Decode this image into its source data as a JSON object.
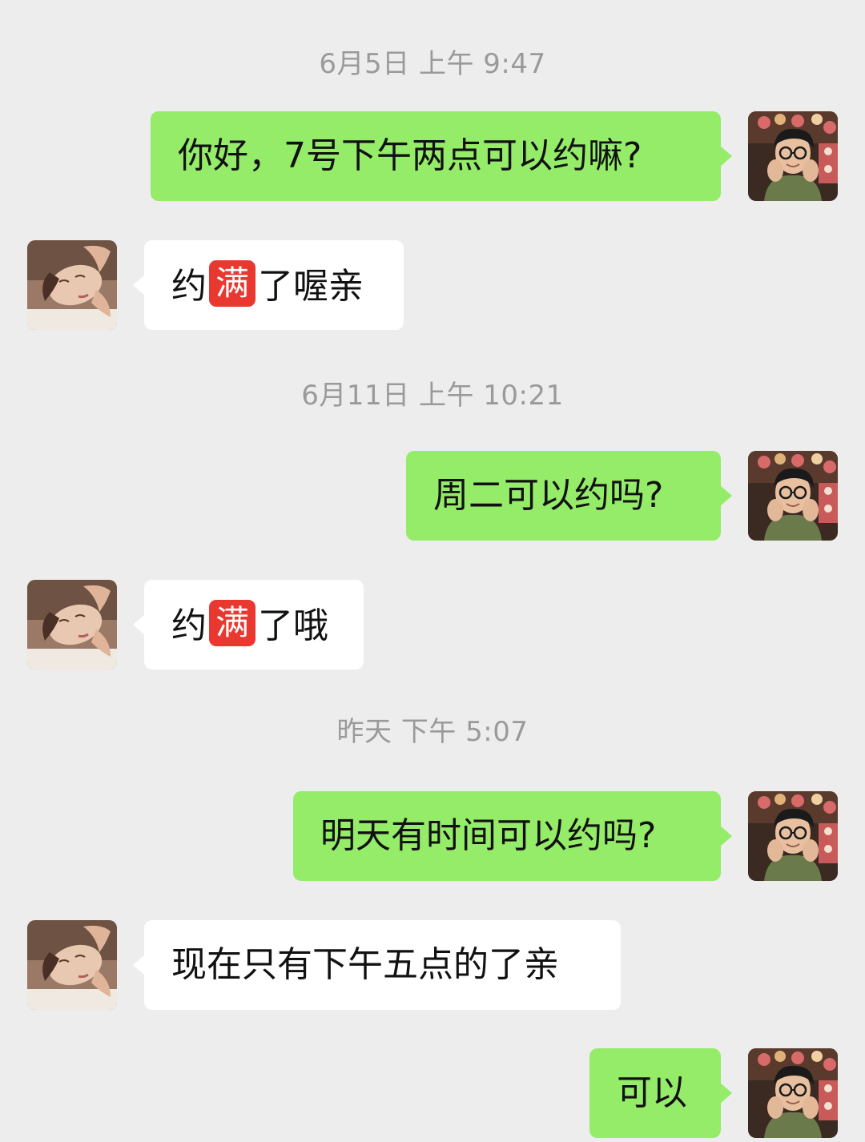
{
  "conversation": {
    "timestamps": [
      "6月5日 上午 9:47",
      "6月11日 上午 10:21",
      "昨天 下午 5:07"
    ],
    "messages": [
      {
        "sender": "me",
        "text": "你好，7号下午两点可以约嘛?"
      },
      {
        "sender": "them",
        "before": "约",
        "badge": "满",
        "after": "了喔亲"
      },
      {
        "sender": "me",
        "text": "周二可以约吗?"
      },
      {
        "sender": "them",
        "before": "约",
        "badge": "满",
        "after": "了哦"
      },
      {
        "sender": "me",
        "text": "明天有时间可以约吗?"
      },
      {
        "sender": "them",
        "text": "现在只有下午五点的了亲"
      },
      {
        "sender": "me",
        "text": "可以"
      }
    ]
  },
  "colors": {
    "background": "#ededed",
    "my_bubble": "#95ec69",
    "their_bubble": "#ffffff",
    "timestamp_text": "#9a9a9a",
    "full_badge": "#e8382f"
  },
  "avatars": {
    "me": "user-avatar-man-with-glasses",
    "them": "contact-avatar-massage"
  }
}
